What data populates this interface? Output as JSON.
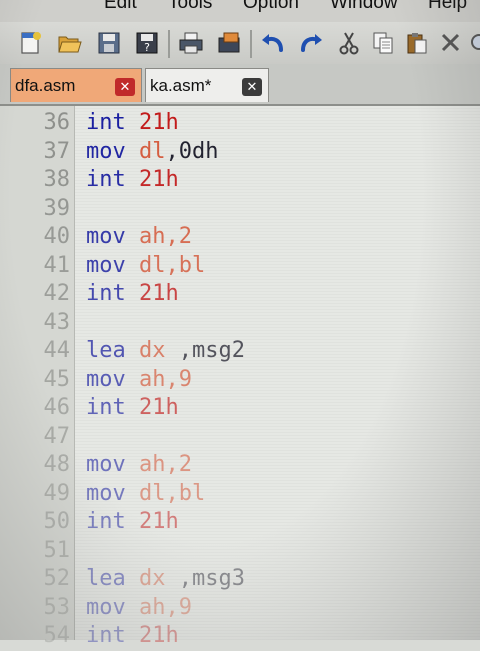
{
  "menu": {
    "items": [
      "Edit",
      "Tools",
      "Option",
      "Window",
      "Help"
    ]
  },
  "toolbar": {
    "buttons": [
      "new-file-icon",
      "open-folder-icon",
      "save-icon",
      "save-as-icon",
      "print-icon",
      "print-preview-icon",
      "undo-icon",
      "redo-icon",
      "cut-icon",
      "copy-icon",
      "paste-icon",
      "delete-icon"
    ]
  },
  "tabs": [
    {
      "label": "dfa.asm",
      "active": true,
      "color": "#f0a878"
    },
    {
      "label": "ka.asm*",
      "active": false,
      "color": "#eeeeec"
    }
  ],
  "tab_close_glyph": "✕",
  "colors": {
    "keyword": "#1a1fa0",
    "register": "#d55a3c",
    "number": "#c21b1b",
    "line_number": "#8e908c"
  },
  "editor": {
    "lines": [
      {
        "num": "36",
        "tokens": [
          {
            "t": "int ",
            "c": "kw"
          },
          {
            "t": "21h",
            "c": "num"
          }
        ]
      },
      {
        "num": "37",
        "tokens": [
          {
            "t": "mov ",
            "c": "kw"
          },
          {
            "t": "dl",
            "c": "reg"
          },
          {
            "t": ",0dh",
            "c": "pl"
          }
        ]
      },
      {
        "num": "38",
        "tokens": [
          {
            "t": "int ",
            "c": "kw"
          },
          {
            "t": "21h",
            "c": "num"
          }
        ]
      },
      {
        "num": "39",
        "tokens": []
      },
      {
        "num": "40",
        "tokens": [
          {
            "t": "mov ",
            "c": "kw"
          },
          {
            "t": "ah",
            "c": "reg"
          },
          {
            "t": ",2",
            "c": "reg"
          }
        ]
      },
      {
        "num": "41",
        "tokens": [
          {
            "t": "mov ",
            "c": "kw"
          },
          {
            "t": "dl",
            "c": "reg"
          },
          {
            "t": ",bl",
            "c": "reg"
          }
        ]
      },
      {
        "num": "42",
        "tokens": [
          {
            "t": "int ",
            "c": "kw"
          },
          {
            "t": "21h",
            "c": "num"
          }
        ]
      },
      {
        "num": "43",
        "tokens": []
      },
      {
        "num": "44",
        "tokens": [
          {
            "t": "lea ",
            "c": "kw"
          },
          {
            "t": "dx",
            "c": "reg"
          },
          {
            "t": " ,msg2",
            "c": "pl"
          }
        ]
      },
      {
        "num": "45",
        "tokens": [
          {
            "t": "mov ",
            "c": "kw"
          },
          {
            "t": "ah",
            "c": "reg"
          },
          {
            "t": ",9",
            "c": "reg"
          }
        ]
      },
      {
        "num": "46",
        "tokens": [
          {
            "t": "int ",
            "c": "kw"
          },
          {
            "t": "21h",
            "c": "num"
          }
        ]
      },
      {
        "num": "47",
        "tokens": []
      },
      {
        "num": "48",
        "tokens": [
          {
            "t": "mov ",
            "c": "kw"
          },
          {
            "t": "ah",
            "c": "reg"
          },
          {
            "t": ",2",
            "c": "reg"
          }
        ]
      },
      {
        "num": "49",
        "tokens": [
          {
            "t": "mov ",
            "c": "kw"
          },
          {
            "t": "dl",
            "c": "reg"
          },
          {
            "t": ",bl",
            "c": "reg"
          }
        ]
      },
      {
        "num": "50",
        "tokens": [
          {
            "t": "int ",
            "c": "kw"
          },
          {
            "t": "21h",
            "c": "num"
          }
        ]
      },
      {
        "num": "51",
        "tokens": []
      },
      {
        "num": "52",
        "tokens": [
          {
            "t": "lea ",
            "c": "kw"
          },
          {
            "t": "dx",
            "c": "reg"
          },
          {
            "t": " ,msg3",
            "c": "pl"
          }
        ]
      },
      {
        "num": "53",
        "tokens": [
          {
            "t": "mov ",
            "c": "kw"
          },
          {
            "t": "ah",
            "c": "reg"
          },
          {
            "t": ",9",
            "c": "reg"
          }
        ]
      },
      {
        "num": "54",
        "tokens": [
          {
            "t": "int ",
            "c": "kw"
          },
          {
            "t": "21h",
            "c": "num"
          }
        ]
      }
    ]
  }
}
